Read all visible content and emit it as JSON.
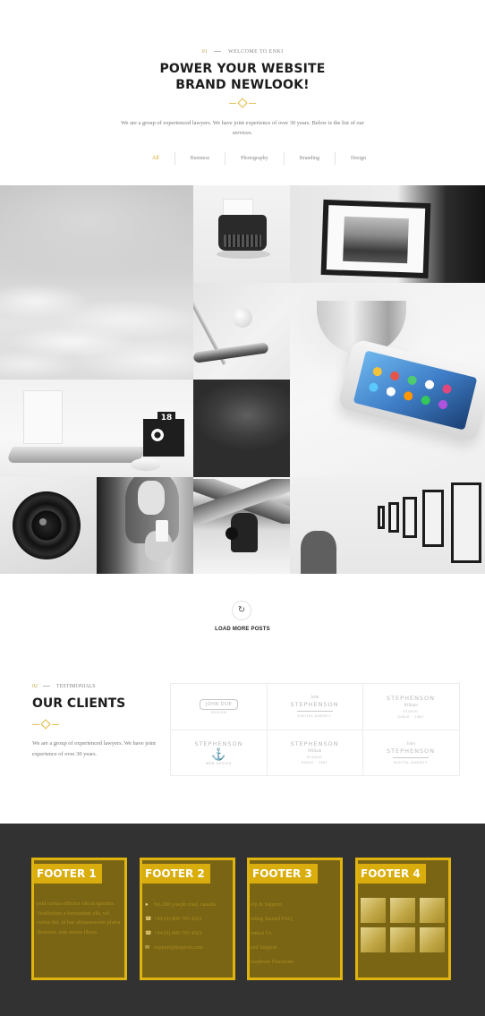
{
  "intro": {
    "number": "01",
    "eyebrow": "WELCOME TO ENKI",
    "title_line1": "POWER YOUR WEBSITE",
    "title_line2": "BRAND NEWLOOK!",
    "description": "We are a group of experienced lawyers. We have joint experience of over 30 years. Below is the list of our services."
  },
  "filters": [
    "All",
    "Business",
    "Photography",
    "Branding",
    "Design"
  ],
  "filter_active": "All",
  "load_more": {
    "label": "LOAD MORE POSTS",
    "icon": "refresh-icon"
  },
  "clients": {
    "number": "02",
    "eyebrow": "TESTIMONIALS",
    "title": "OUR CLIENTS",
    "description": "We are a group of experienced lawyers. We have joint experience of over 30 years.",
    "logos": [
      {
        "top": "JOHN DOE",
        "sub": "DESIGN"
      },
      {
        "script": "John",
        "main": "STEPHENSON",
        "sub": "DIGITAL AGENCY"
      },
      {
        "main": "STEPHENSON",
        "script": "William",
        "sub": "STUDIO",
        "year": "SINCE · 1987"
      },
      {
        "main": "STEPHENSON",
        "sub": "WEB DESIGN"
      },
      {
        "main": "STEPHENSON",
        "script": "William",
        "sub": "STUDIO",
        "year": "SINCE · 1987"
      },
      {
        "script": "John",
        "main": "STEPHENSON",
        "sub": "DIGITAL AGENCY"
      }
    ]
  },
  "footer": {
    "col1": {
      "title": "FOOTER 1",
      "text": "psid cursus efficitur elit at rgismtis. Vestibulum a fermentum elit, vel varius dui. in hac abitasseavem platea dictumst. unts metus libero."
    },
    "col2": {
      "title": "FOOTER 2",
      "items": [
        {
          "icon": "map-pin-icon",
          "text": "No.200 joseph road, canada"
        },
        {
          "icon": "phone-icon",
          "text": "+44 (0) 800 765 4321"
        },
        {
          "icon": "phone-icon",
          "text": "+44 (0) 800 765 4321"
        },
        {
          "icon": "mail-icon",
          "text": "support@ttoptorr.com"
        }
      ]
    },
    "col3": {
      "title": "FOOTER 3",
      "links": [
        "elp & Support",
        "etting Started FAQ",
        "ontact Us",
        "eed Support",
        "elephone Functions"
      ]
    },
    "col4": {
      "title": "FOOTER 4"
    }
  },
  "colors": {
    "accent": "#e0b40e",
    "footer_bg": "#323232",
    "footer_col_bg": "#7a6515"
  }
}
